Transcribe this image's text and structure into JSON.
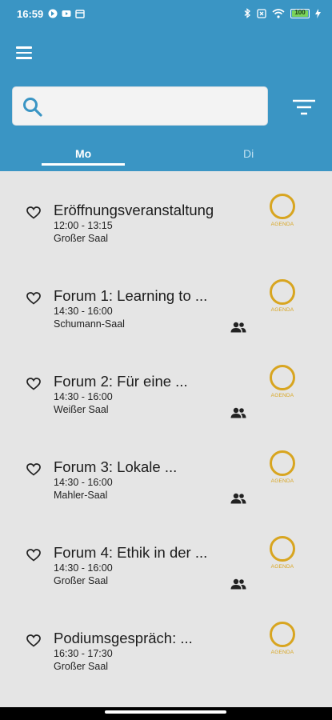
{
  "status_bar": {
    "time": "16:59",
    "battery": "100",
    "icons": [
      "location-icon",
      "youtube-icon",
      "calendar-icon",
      "bluetooth-icon",
      "sim-icon",
      "wifi-icon",
      "battery-icon",
      "charging-icon"
    ]
  },
  "app_bar": {
    "menu_icon": "hamburger-menu-icon"
  },
  "search": {
    "placeholder": "",
    "value": "",
    "icon": "search-icon",
    "filter_icon": "filter-icon"
  },
  "tabs": [
    {
      "label": "Mo",
      "selected": true
    },
    {
      "label": "Di",
      "selected": false
    }
  ],
  "agenda_label": "AGENDA",
  "sessions": [
    {
      "title": "Eröffnungsveranstaltung",
      "time": "12:00 - 13:15",
      "room": "Großer Saal",
      "group": false
    },
    {
      "title": "Forum 1: Learning to ...",
      "time": "14:30 - 16:00",
      "room": "Schumann-Saal",
      "group": true
    },
    {
      "title": "Forum 2: Für eine ...",
      "time": "14:30 - 16:00",
      "room": "Weißer Saal",
      "group": true
    },
    {
      "title": "Forum 3: Lokale ...",
      "time": "14:30 - 16:00",
      "room": "Mahler-Saal",
      "group": true
    },
    {
      "title": "Forum 4: Ethik in der ...",
      "time": "14:30 - 16:00",
      "room": "Großer Saal",
      "group": true
    },
    {
      "title": "Podiumsgespräch: ...",
      "time": "16:30 - 17:30",
      "room": "Großer Saal",
      "group": false
    }
  ],
  "colors": {
    "primary": "#3a95c4",
    "accent": "#d8a520",
    "background": "#e5e5e5"
  }
}
